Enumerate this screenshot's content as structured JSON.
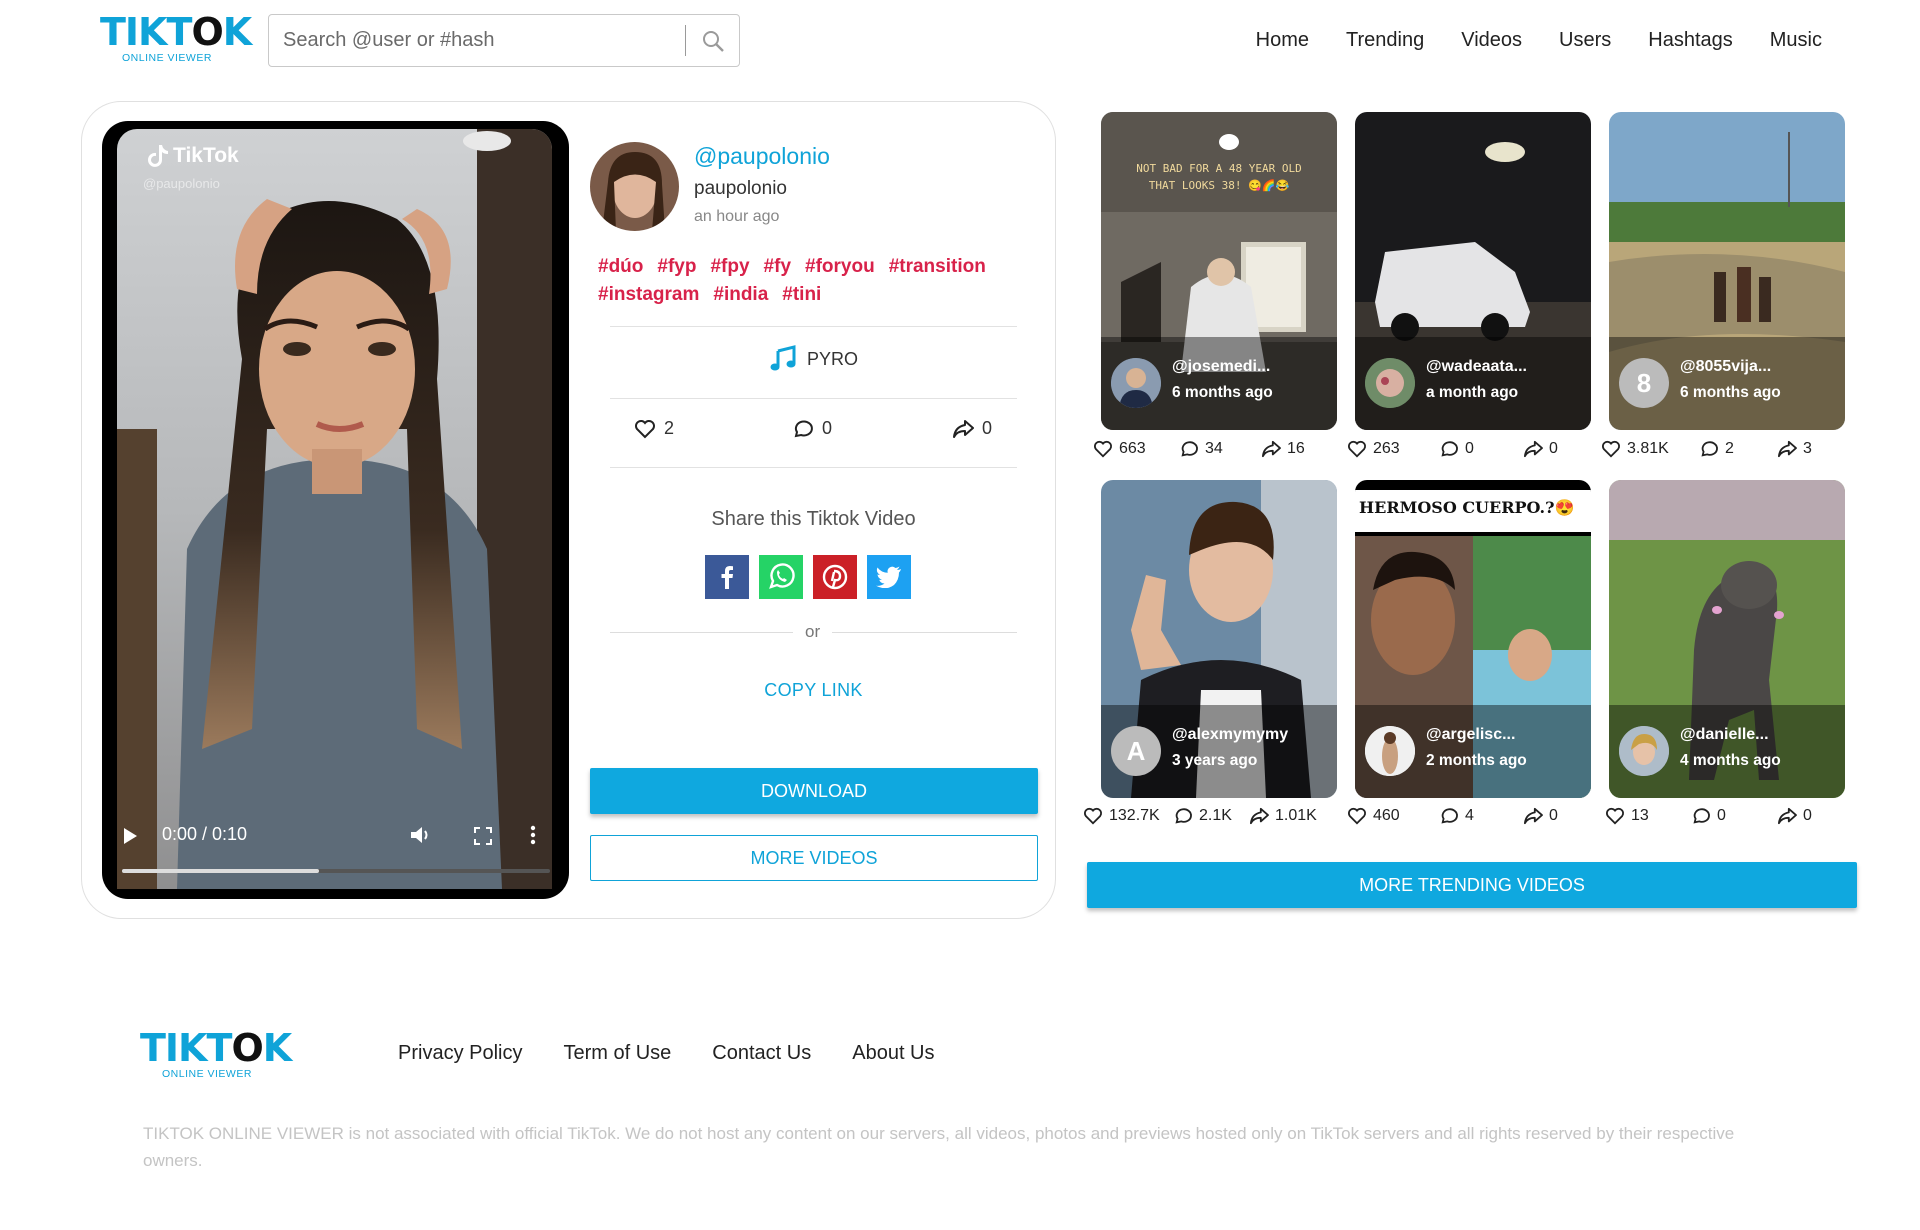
{
  "header": {
    "logo_text": "TIKTOK",
    "logo_sub": "ONLINE VIEWER",
    "search_placeholder": "Search @user or #hash",
    "nav": [
      "Home",
      "Trending",
      "Videos",
      "Users",
      "Hashtags",
      "Music"
    ]
  },
  "video": {
    "player_brand": "TikTok",
    "player_handle": "@paupolonio",
    "current_time": "0:00",
    "duration": "0:10",
    "time_display": "0:00 / 0:10",
    "progress": 0.46,
    "username": "@paupolonio",
    "nickname": "paupolonio",
    "posted": "an hour ago",
    "hashtags": [
      "#dúo",
      "#fyp",
      "#fpy",
      "#fy",
      "#foryou",
      "#transition",
      "#instagram",
      "#india",
      "#tini"
    ],
    "music": "PYRO",
    "likes": "2",
    "comments": "0",
    "shares": "0",
    "share_title": "Share this Tiktok Video",
    "or": "or",
    "copy_link": "COPY LINK",
    "download": "DOWNLOAD",
    "more_videos": "MORE VIDEOS",
    "social_colors": {
      "facebook": "#3b5998",
      "whatsapp": "#25d366",
      "pinterest": "#cb2027",
      "twitter": "#1da1f2"
    }
  },
  "trending": [
    {
      "handle": "@josemedi...",
      "time": "6 months ago",
      "likes": "663",
      "comments": "34",
      "shares": "16",
      "caption": "NOT BAD FOR A 48 YEAR OLD THAT LOOKS 38! 😋🌈😂",
      "avatar_letter": ""
    },
    {
      "handle": "@wadeaata...",
      "time": "a month ago",
      "likes": "263",
      "comments": "0",
      "shares": "0",
      "caption": "",
      "avatar_letter": ""
    },
    {
      "handle": "@8055vija...",
      "time": "6 months ago",
      "likes": "3.81K",
      "comments": "2",
      "shares": "3",
      "caption": "",
      "avatar_letter": "8"
    },
    {
      "handle": "@alexmymymy",
      "time": "3 years ago",
      "likes": "132.7K",
      "comments": "2.1K",
      "shares": "1.01K",
      "caption": "",
      "avatar_letter": "A"
    },
    {
      "handle": "@argelisc...",
      "time": "2 months ago",
      "likes": "460",
      "comments": "4",
      "shares": "0",
      "caption": "HERMOSO CUERPO.?😍",
      "avatar_letter": ""
    },
    {
      "handle": "@danielle...",
      "time": "4 months ago",
      "likes": "13",
      "comments": "0",
      "shares": "0",
      "caption": "",
      "avatar_letter": ""
    }
  ],
  "more_trending": "MORE TRENDING VIDEOS",
  "footer": {
    "logo_text": "TIKTOK",
    "logo_sub": "ONLINE VIEWER",
    "links": [
      "Privacy Policy",
      "Term of Use",
      "Contact Us",
      "About Us"
    ],
    "disclaimer": "TIKTOK ONLINE VIEWER is not associated with official TikTok. We do not host any content on our servers, all videos, photos and previews hosted only on TikTok servers and all rights reserved by their respective owners."
  },
  "colors": {
    "accent": "#0fa3d8",
    "hashtag": "#d8224a"
  }
}
